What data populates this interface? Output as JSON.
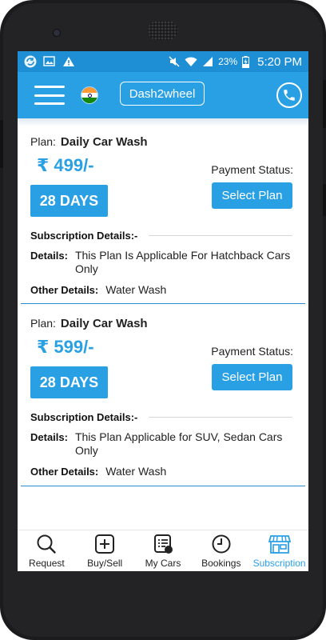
{
  "status_bar": {
    "battery_percent": "23%",
    "time": "5:20 PM"
  },
  "app_bar": {
    "brand_label": "Dash2wheel"
  },
  "plans": [
    {
      "plan_label": "Plan:",
      "plan_name": "Daily Car Wash",
      "price": "₹ 499/-",
      "days": "28 DAYS",
      "payment_status_label": "Payment Status:",
      "select_label": "Select Plan",
      "subscription_label": "Subscription Details:-",
      "details_label": "Details:",
      "details_value": "This Plan Is Applicable For Hatchback Cars Only",
      "other_label": "Other Details:",
      "other_value": "Water Wash"
    },
    {
      "plan_label": "Plan:",
      "plan_name": "Daily Car Wash",
      "price": "₹ 599/-",
      "days": "28 DAYS",
      "payment_status_label": "Payment Status:",
      "select_label": "Select Plan",
      "subscription_label": "Subscription Details:-",
      "details_label": "Details:",
      "details_value": "This Plan Applicable for SUV, Sedan Cars Only",
      "other_label": "Other Details:",
      "other_value": "Water Wash"
    }
  ],
  "bottom_nav": {
    "items": [
      {
        "label": "Request",
        "icon": "search-icon"
      },
      {
        "label": "Buy/Sell",
        "icon": "plus-square-icon"
      },
      {
        "label": "My Cars",
        "icon": "list-icon"
      },
      {
        "label": "Bookings",
        "icon": "clock-icon"
      },
      {
        "label": "Subscription",
        "icon": "store-icon"
      }
    ],
    "active": "Subscription"
  },
  "colors": {
    "status_bar": "#1e8fd4",
    "app_bar": "#2aa0e4",
    "accent": "#2aa0e4",
    "divider": "#2a8ad0"
  }
}
